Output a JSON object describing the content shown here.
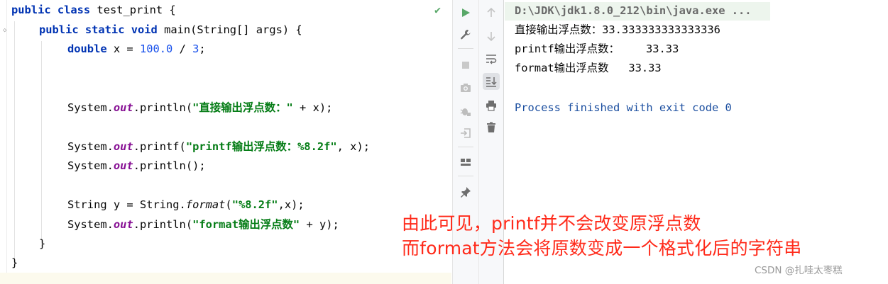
{
  "editor": {
    "lines": {
      "l1": {
        "kw": "public class",
        "rest": " test_print {"
      },
      "l2": {
        "kw": "public static void",
        "rest": " main(String[] args) {"
      },
      "l3": {
        "kw": "double",
        "mid": " x = ",
        "num1": "100.0",
        "op": " / ",
        "num2": "3",
        "end": ";"
      },
      "l4": {
        "a": "System.",
        "fld": "out",
        "b": ".println(",
        "str": "\"直接输出浮点数：\"",
        "c": " + x);"
      },
      "l5": {
        "a": "System.",
        "fld": "out",
        "b": ".printf(",
        "str": "\"printf输出浮点数：%8.2f\"",
        "c": ", x);"
      },
      "l6": {
        "a": "System.",
        "fld": "out",
        "b": ".println();"
      },
      "l7": {
        "a": "String y = String.",
        "ital": "format",
        "b": "(",
        "str": "\"%8.2f\"",
        "c": ",x);"
      },
      "l8": {
        "a": "System.",
        "fld": "out",
        "b": ".println(",
        "str": "\"format输出浮点数\"",
        "c": " + y);"
      },
      "l9": {
        "text": "}"
      },
      "l10": {
        "text": "}"
      }
    },
    "status_icon": "checkmark-icon"
  },
  "toolbar": {
    "left": [
      "run-icon",
      "wrench-icon",
      "stop-icon",
      "camera-icon",
      "debug-icon",
      "login-icon",
      "layout-icon",
      "pin-icon"
    ],
    "right": [
      "up-arrow-icon",
      "down-arrow-icon",
      "soft-wrap-icon",
      "scroll-to-end-icon",
      "print-icon",
      "trash-icon"
    ]
  },
  "console": {
    "command": "D:\\JDK\\jdk1.8.0_212\\bin\\java.exe ...",
    "out1": "直接输出浮点数：33.333333333333336",
    "out2": "printf输出浮点数：    33.33",
    "out3": "format输出浮点数   33.33",
    "finished": "Process finished with exit code 0"
  },
  "annotation": {
    "line1": "由此可见，printf并不会改变原浮点数",
    "line2": "而format方法会将原数变成一个格式化后的字符串"
  },
  "watermark": "CSDN @扎哇太枣糕",
  "colors": {
    "keyword": "#0033b3",
    "number": "#1750eb",
    "string": "#067d17",
    "field": "#871094",
    "annotation": "#ff2a1a",
    "run_green": "#59a869",
    "process_text": "#1c4fa0"
  }
}
